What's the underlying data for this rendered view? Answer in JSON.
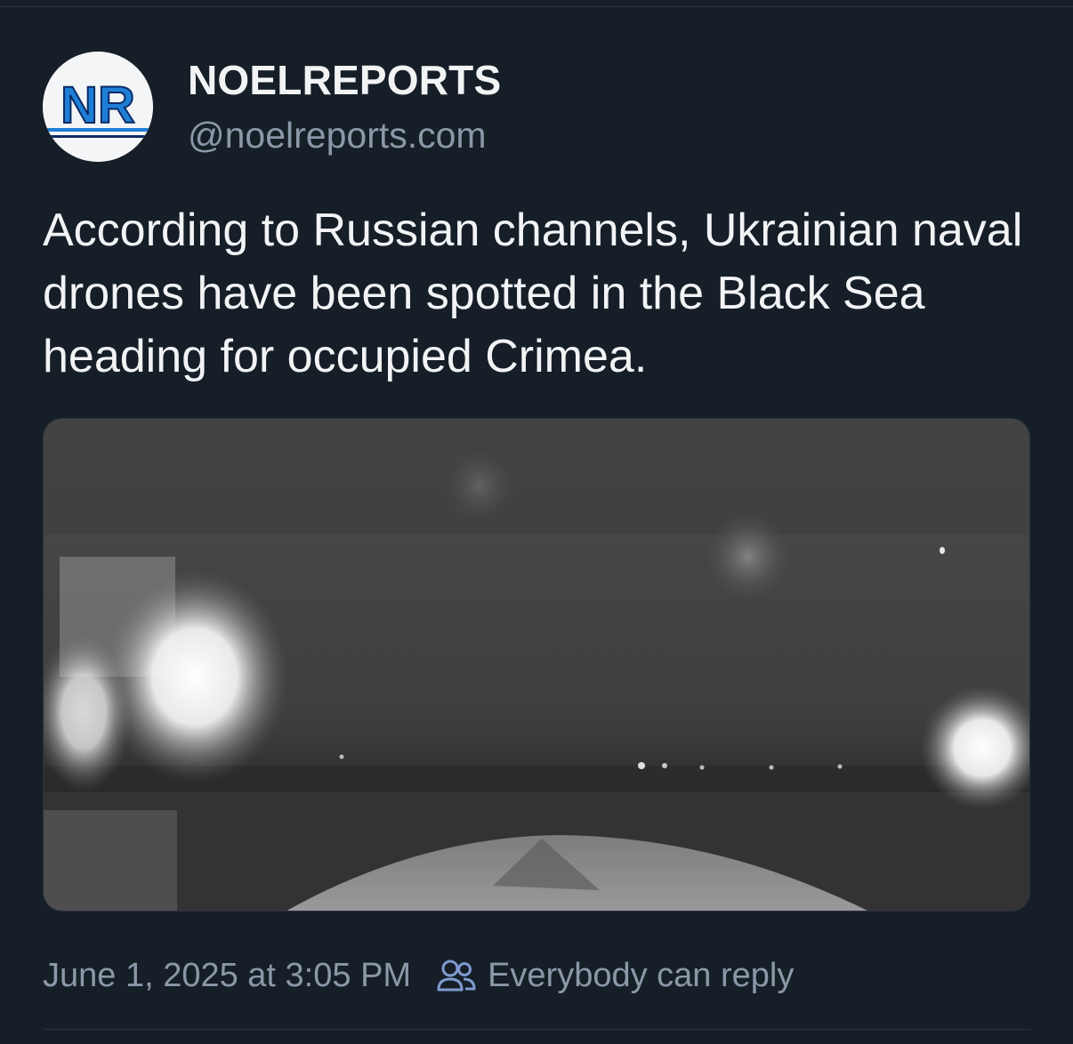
{
  "post": {
    "author": {
      "display_name": "NOELREPORTS",
      "handle": "@noelreports.com",
      "avatar_text": "NR"
    },
    "text": "According to Russian channels, Ukrainian naval drones have been spotted in the Black Sea heading for occupied Crimea.",
    "media": {
      "type": "video-still",
      "icon": "image-embed"
    },
    "timestamp": "June 1, 2025 at 3:05 PM",
    "reply_setting": {
      "icon": "people-icon",
      "label": "Everybody can reply"
    }
  },
  "colors": {
    "background": "#161e27",
    "primary_text": "#f1f3f5",
    "secondary_text": "#8b98a8",
    "avatar_blue": "#1f7fd6"
  }
}
